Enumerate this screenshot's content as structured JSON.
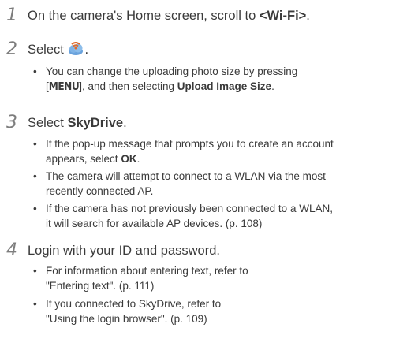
{
  "steps": [
    {
      "number": "1",
      "text_before": "On the camera's Home screen, scroll to ",
      "text_bold": "<Wi-Fi>",
      "text_after": "."
    },
    {
      "number": "2",
      "text_before": "Select ",
      "icon": "wifi-cloud-icon",
      "text_after": ".",
      "bullets": [
        {
          "t1": "You can change the uploading photo size by pressing\n[",
          "key": "MENU",
          "t2": "], and then selecting ",
          "bold": "Upload Image Size",
          "t3": "."
        }
      ]
    },
    {
      "number": "3",
      "text_before": "Select ",
      "text_bold": "SkyDrive",
      "text_after": ".",
      "bullets": [
        {
          "t1": "If the pop-up message that prompts you to create an account\nappears, select ",
          "bold": "OK",
          "t2": "."
        },
        {
          "t1": "The camera will attempt to connect to a WLAN via the most\nrecently connected AP."
        },
        {
          "t1": "If the camera has not previously been connected to a WLAN,\nit will search for available AP devices. (p. 108)"
        }
      ]
    },
    {
      "number": "4",
      "text": "Login with your ID and password.",
      "bullets": [
        {
          "t1": "For information about entering text, refer to\n\"Entering text\". (p. 111)"
        },
        {
          "t1": "If you connected to SkyDrive, refer to\n\"Using the login browser\". (p. 109)"
        }
      ]
    }
  ],
  "colors": {
    "text": "#3a3a3a",
    "step_number": "#7d7d7d",
    "icon_cloud": "#6aa2dc",
    "icon_wave": "#e06a2a"
  }
}
